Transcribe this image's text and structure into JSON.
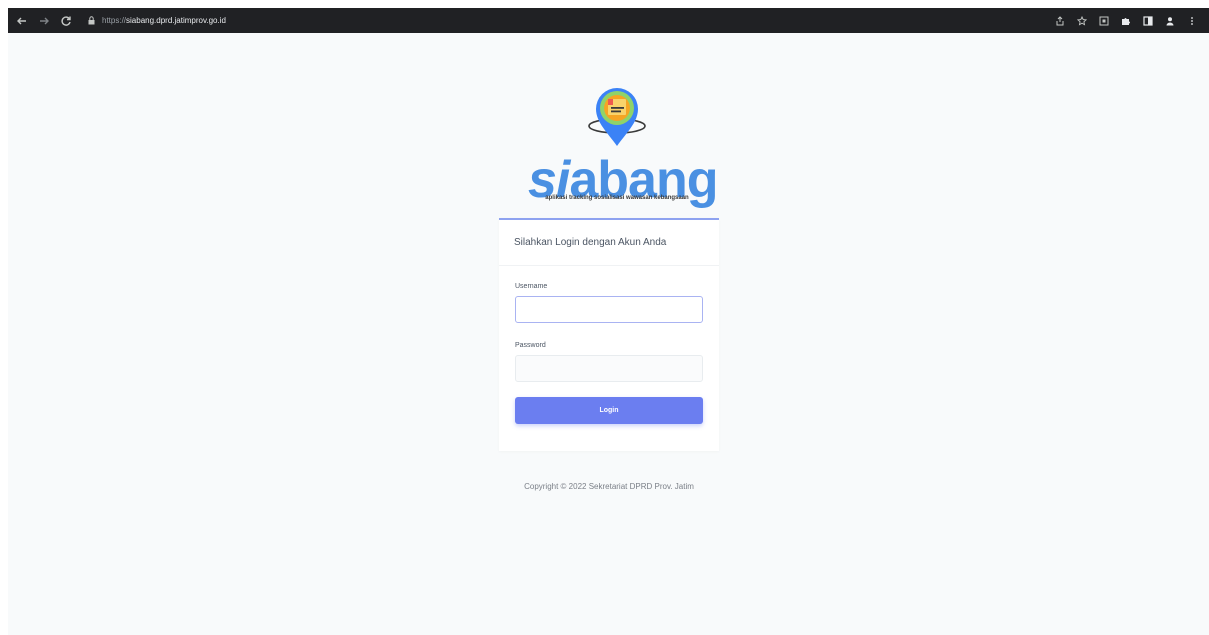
{
  "browser": {
    "url_protocol": "https://",
    "url_host": "siabang.dprd.jatimprov.go.id"
  },
  "logo": {
    "word_si": "si",
    "word_abang": "abang",
    "tagline": "aplikasi tracking sosialisasi wawasan kebangsaan",
    "colors": {
      "brand_blue": "#4a90e2",
      "pin_blue": "#3b82f6",
      "pin_ring": "#8fd36a"
    }
  },
  "login": {
    "header": "Silahkan Login dengan Akun Anda",
    "username_label": "Username",
    "username_value": "",
    "password_label": "Password",
    "password_value": "",
    "submit_label": "Login",
    "accent_color": "#6b7ef0"
  },
  "footer": {
    "copyright": "Copyright © 2022 Sekretariat DPRD Prov. Jatim"
  }
}
